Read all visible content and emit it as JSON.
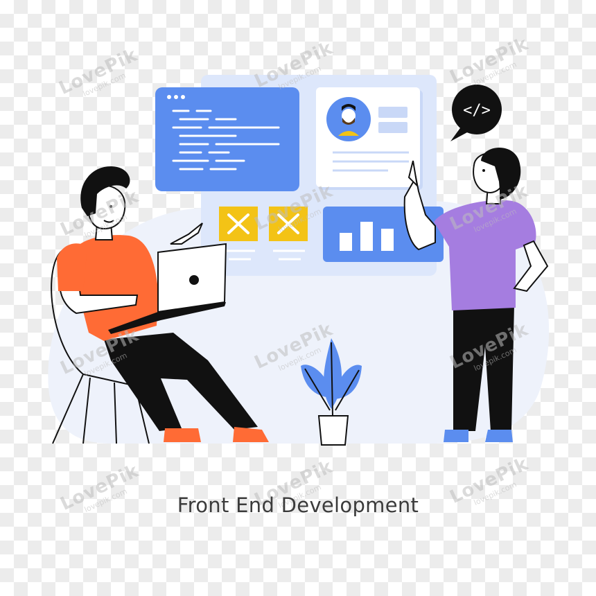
{
  "caption": "Front End Development",
  "code_bubble": {
    "symbol": "</>"
  },
  "watermark": {
    "brand": "LovePik",
    "url": "lovepik.com"
  },
  "colors": {
    "blue": "#5b8def",
    "light_blue": "#dde7fb",
    "yellow": "#f3c316",
    "orange": "#ff6b35",
    "purple": "#a57de0",
    "black": "#111111"
  }
}
